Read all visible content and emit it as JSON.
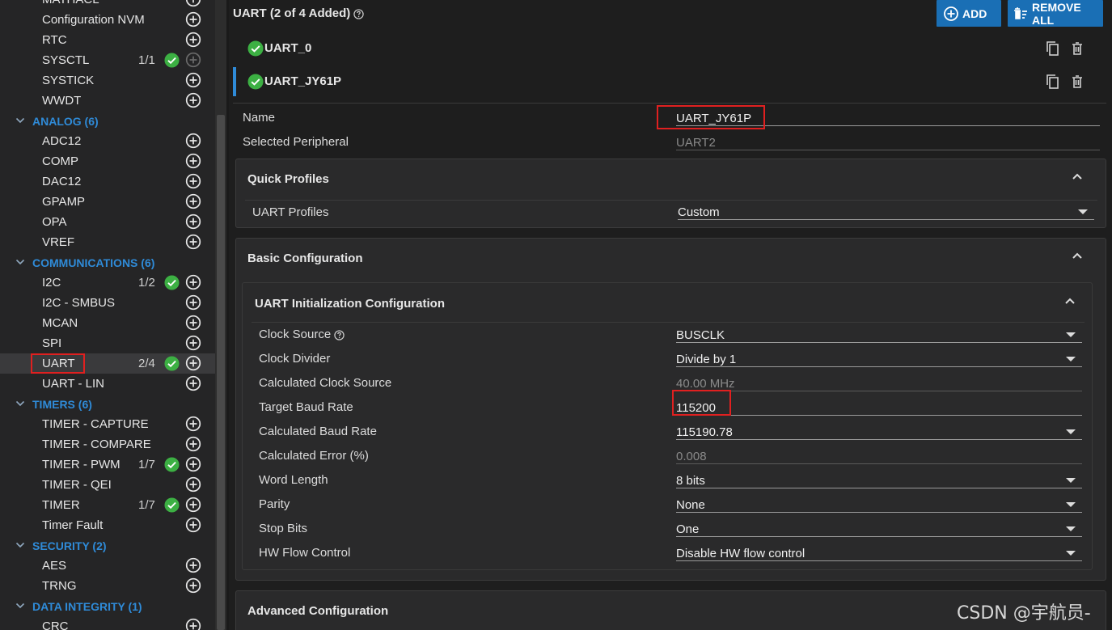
{
  "sidebar": {
    "rows": [
      {
        "kind": "item",
        "label": "MATHACL",
        "count": "",
        "checked": false,
        "add_disabled": false
      },
      {
        "kind": "item",
        "label": "Configuration NVM",
        "count": "",
        "checked": false,
        "add_disabled": false
      },
      {
        "kind": "item",
        "label": "RTC",
        "count": "",
        "checked": false,
        "add_disabled": false
      },
      {
        "kind": "item",
        "label": "SYSCTL",
        "count": "1/1",
        "checked": true,
        "add_disabled": true
      },
      {
        "kind": "item",
        "label": "SYSTICK",
        "count": "",
        "checked": false,
        "add_disabled": false
      },
      {
        "kind": "item",
        "label": "WWDT",
        "count": "",
        "checked": false,
        "add_disabled": false
      },
      {
        "kind": "category",
        "label": "ANALOG (6)"
      },
      {
        "kind": "item",
        "label": "ADC12",
        "count": "",
        "checked": false,
        "add_disabled": false
      },
      {
        "kind": "item",
        "label": "COMP",
        "count": "",
        "checked": false,
        "add_disabled": false
      },
      {
        "kind": "item",
        "label": "DAC12",
        "count": "",
        "checked": false,
        "add_disabled": false
      },
      {
        "kind": "item",
        "label": "GPAMP",
        "count": "",
        "checked": false,
        "add_disabled": false
      },
      {
        "kind": "item",
        "label": "OPA",
        "count": "",
        "checked": false,
        "add_disabled": false
      },
      {
        "kind": "item",
        "label": "VREF",
        "count": "",
        "checked": false,
        "add_disabled": false
      },
      {
        "kind": "category",
        "label": "COMMUNICATIONS (6)"
      },
      {
        "kind": "item",
        "label": "I2C",
        "count": "1/2",
        "checked": true,
        "add_disabled": false
      },
      {
        "kind": "item",
        "label": "I2C - SMBUS",
        "count": "",
        "checked": false,
        "add_disabled": false
      },
      {
        "kind": "item",
        "label": "MCAN",
        "count": "",
        "checked": false,
        "add_disabled": false
      },
      {
        "kind": "item",
        "label": "SPI",
        "count": "",
        "checked": false,
        "add_disabled": false
      },
      {
        "kind": "item",
        "label": "UART",
        "count": "2/4",
        "checked": true,
        "add_disabled": false,
        "selected": true
      },
      {
        "kind": "item",
        "label": "UART - LIN",
        "count": "",
        "checked": false,
        "add_disabled": false
      },
      {
        "kind": "category",
        "label": "TIMERS (6)"
      },
      {
        "kind": "item",
        "label": "TIMER - CAPTURE",
        "count": "",
        "checked": false,
        "add_disabled": false
      },
      {
        "kind": "item",
        "label": "TIMER - COMPARE",
        "count": "",
        "checked": false,
        "add_disabled": false
      },
      {
        "kind": "item",
        "label": "TIMER - PWM",
        "count": "1/7",
        "checked": true,
        "add_disabled": false
      },
      {
        "kind": "item",
        "label": "TIMER - QEI",
        "count": "",
        "checked": false,
        "add_disabled": false
      },
      {
        "kind": "item",
        "label": "TIMER",
        "count": "1/7",
        "checked": true,
        "add_disabled": false
      },
      {
        "kind": "item",
        "label": "Timer Fault",
        "count": "",
        "checked": false,
        "add_disabled": false
      },
      {
        "kind": "category",
        "label": "SECURITY (2)"
      },
      {
        "kind": "item",
        "label": "AES",
        "count": "",
        "checked": false,
        "add_disabled": false
      },
      {
        "kind": "item",
        "label": "TRNG",
        "count": "",
        "checked": false,
        "add_disabled": false
      },
      {
        "kind": "category",
        "label": "DATA INTEGRITY (1)"
      },
      {
        "kind": "item",
        "label": "CRC",
        "count": "",
        "checked": false,
        "add_disabled": false
      }
    ]
  },
  "header": {
    "title": "UART (2 of 4 Added)",
    "add_label": "ADD",
    "remove_all_label": "REMOVE ALL"
  },
  "instances": [
    {
      "name": "UART_0",
      "active": false
    },
    {
      "name": "UART_JY61P",
      "active": true
    }
  ],
  "general": {
    "name_label": "Name",
    "name_value": "UART_JY61P",
    "peripheral_label": "Selected Peripheral",
    "peripheral_value": "UART2"
  },
  "quick_profiles": {
    "title": "Quick Profiles",
    "profiles_label": "UART Profiles",
    "profiles_value": "Custom"
  },
  "basic_config": {
    "title": "Basic Configuration",
    "init_title": "UART Initialization Configuration",
    "fields": [
      {
        "label": "Clock Source",
        "value": "BUSCLK",
        "type": "dropdown",
        "help": true
      },
      {
        "label": "Clock Divider",
        "value": "Divide by 1",
        "type": "dropdown"
      },
      {
        "label": "Calculated Clock Source",
        "value": "40.00 MHz",
        "type": "readonly"
      },
      {
        "label": "Target Baud Rate",
        "value": "115200",
        "type": "input"
      },
      {
        "label": "Calculated Baud Rate",
        "value": "115190.78",
        "type": "dropdown"
      },
      {
        "label": "Calculated Error (%)",
        "value": "0.008",
        "type": "readonly"
      },
      {
        "label": "Word Length",
        "value": "8 bits",
        "type": "dropdown"
      },
      {
        "label": "Parity",
        "value": "None",
        "type": "dropdown"
      },
      {
        "label": "Stop Bits",
        "value": "One",
        "type": "dropdown"
      },
      {
        "label": "HW Flow Control",
        "value": "Disable HW flow control",
        "type": "dropdown"
      }
    ]
  },
  "advanced_config": {
    "title": "Advanced Configuration"
  },
  "watermark": "CSDN @宇航员-",
  "colors": {
    "accent": "#1a6fb5",
    "category": "#2f8bd8",
    "check": "#3cb043",
    "highlight": "#e02020"
  }
}
